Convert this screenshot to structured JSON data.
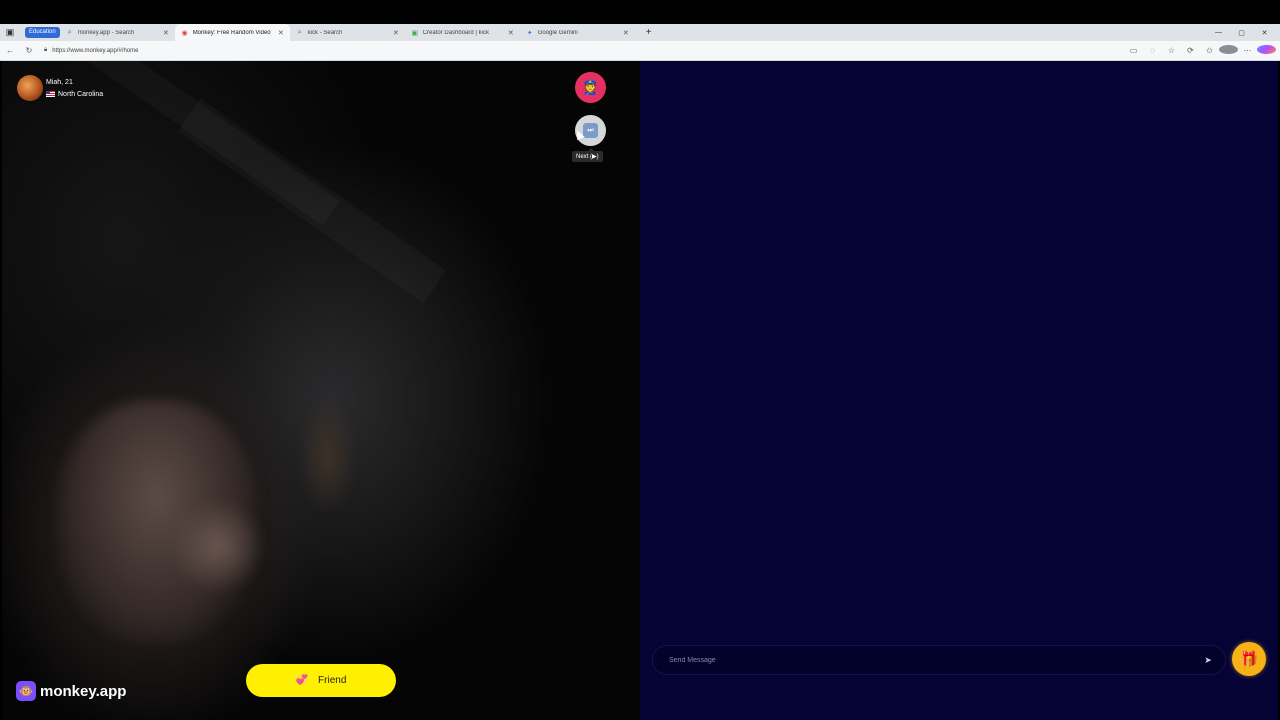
{
  "browser": {
    "sidebar_icon": "tab-actions-icon",
    "group_label": "Education",
    "tabs": [
      {
        "title": "monkey.app - Search",
        "icon": "search-icon",
        "active": false
      },
      {
        "title": "Monkey: Free Random Video",
        "icon": "monkey-favicon",
        "active": true
      },
      {
        "title": "kick - Search",
        "icon": "search-icon",
        "active": false
      },
      {
        "title": "Creator Dashboard | kick",
        "icon": "kick-favicon",
        "active": false
      },
      {
        "title": "Google Gemini",
        "icon": "gemini-favicon",
        "active": false
      }
    ],
    "url": "https://www.monkey.app/#/home",
    "window_controls": [
      "—",
      "▢",
      "✕"
    ]
  },
  "video": {
    "user_name": "Miah, 21",
    "user_location": "North Carolina",
    "report_icon": "police-officer-icon",
    "next_tooltip": "Next (▶)",
    "brand_name": "monkey.app",
    "friend_label": "Friend"
  },
  "chat": {
    "message_placeholder": "Send Message",
    "send_icon": "send-icon",
    "gift_icon": "gift-icon"
  },
  "colors": {
    "accent_yellow": "#ffef00",
    "report_pink": "#e62f62",
    "chat_bg": "#050336",
    "gift_orange": "#f7b21a",
    "brand_purple": "#7c4dff"
  }
}
